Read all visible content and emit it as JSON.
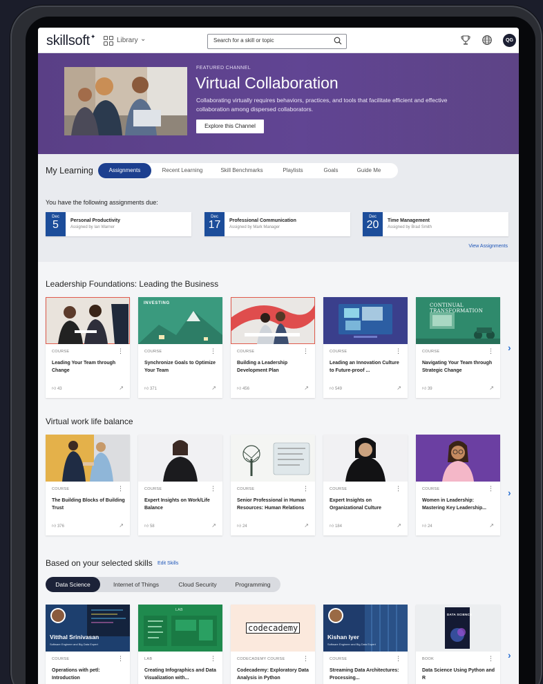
{
  "topnav": {
    "logo": "skillsoft",
    "library_label": "Library",
    "search_placeholder": "Search for a skill or topic",
    "avatar_initials": "QG"
  },
  "hero": {
    "eyebrow": "FEATURED CHANNEL",
    "title": "Virtual Collaboration",
    "description": "Collaborating virtually requires behaviors, practices, and tools that facilitate efficient and effective collaboration among dispersed collaborators.",
    "button": "Explore this Channel"
  },
  "my_learning": {
    "title": "My Learning",
    "tabs": [
      "Assignments",
      "Recent Learning",
      "Skill Benchmarks",
      "Playlists",
      "Goals",
      "Guide Me"
    ],
    "due_text": "You have the following assignments due:",
    "assignments": [
      {
        "month": "Dec",
        "day": "5",
        "title": "Personal Productivity",
        "by": "Assigned by Ian Warner"
      },
      {
        "month": "Dec",
        "day": "17",
        "title": "Professional Communication",
        "by": "Assigned by Mark Manager"
      },
      {
        "month": "Dec",
        "day": "20",
        "title": "Time Management",
        "by": "Assigned by Brad Smith"
      }
    ],
    "view_all": "View Assignments"
  },
  "rows": [
    {
      "title": "Leadership Foundations: Leading the Business",
      "cards": [
        {
          "type": "COURSE",
          "title": "Leading Your Team through Change",
          "likes": "43"
        },
        {
          "type": "COURSE",
          "title": "Synchronize Goals to Optimize Your Team",
          "likes": "371",
          "thumb_text": "INVESTING"
        },
        {
          "type": "COURSE",
          "title": "Building a Leadership Development Plan",
          "likes": "456"
        },
        {
          "type": "COURSE",
          "title": "Leading an Innovation Culture to Future-proof ...",
          "likes": "549"
        },
        {
          "type": "COURSE",
          "title": "Navigating Your Team through Strategic Change",
          "likes": "39",
          "thumb_text": "CONTINUAL TRANSFORMATION"
        }
      ]
    },
    {
      "title": "Virtual work life balance",
      "cards": [
        {
          "type": "COURSE",
          "title": "The Building Blocks of Building Trust",
          "likes": "376"
        },
        {
          "type": "COURSE",
          "title": "Expert Insights on Work/Life Balance",
          "likes": "58"
        },
        {
          "type": "COURSE",
          "title": "Senior Professional in Human Resources: Human Relations",
          "likes": "24"
        },
        {
          "type": "COURSE",
          "title": "Expert Insights on Organizational Culture",
          "likes": "184"
        },
        {
          "type": "COURSE",
          "title": "Women in Leadership: Mastering Key Leadership...",
          "likes": "24"
        }
      ]
    },
    {
      "title": "Based on your selected skills",
      "edit": "Edit Skills",
      "tabs": [
        "Data Science",
        "Internet of Things",
        "Cloud Security",
        "Programming"
      ],
      "cards": [
        {
          "type": "COURSE",
          "title": "Operations with petl: Introduction",
          "thumb_name": "Vitthal Srinivasan",
          "thumb_sub": "Software Engineer and Big Data Expert"
        },
        {
          "type": "LAB",
          "title": "Creating Infographics and Data Visualization with...",
          "thumb_text": "LAB"
        },
        {
          "type": "CODECADEMY COURSE",
          "title": "Codecademy: Exploratory Data Analysis in Python",
          "thumb_text": "codecademy"
        },
        {
          "type": "COURSE",
          "title": "Streaming Data Architectures: Processing...",
          "thumb_name": "Kishan Iyer",
          "thumb_sub": "Software Engineer and Big Data Expert"
        },
        {
          "type": "BOOK",
          "title": "Data Science Using Python and R",
          "thumb_text": "DATA SCIENCE"
        }
      ]
    }
  ],
  "colors": {
    "hero_purple": "#5d418c",
    "accent_blue": "#1c3f8f",
    "date_blue": "#1c4d9a",
    "link_blue": "#1c54b7"
  }
}
